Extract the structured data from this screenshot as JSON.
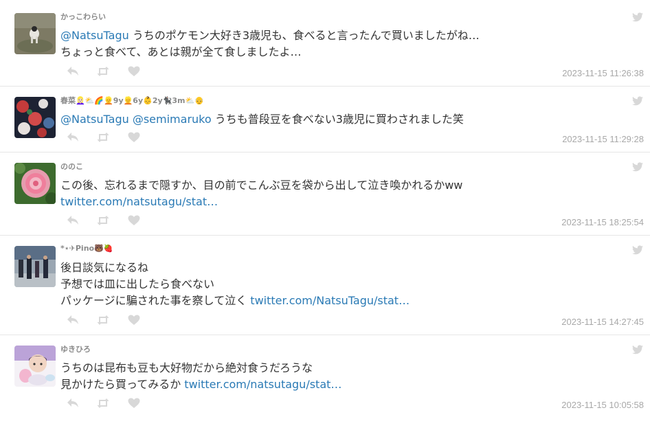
{
  "colors": {
    "link": "#2a7ab5",
    "icon": "#d8d8d8",
    "author": "#8a8a8a",
    "timestamp": "#a8a8a8"
  },
  "tweets": [
    {
      "author": "かっこわらい",
      "line1_pre": "",
      "line1_mention1": "@NatsuTagu",
      "line1_mention2": "",
      "line1_text": " うちのポケモン大好き3歳児も、食べると言ったんで買いましたがね…",
      "line2_text": "ちょっと食べて、あとは親が全て食しましたよ…",
      "line2_link": "",
      "line3_text": "",
      "line3_link": "",
      "timestamp": "2023-11-15 11:26:38"
    },
    {
      "author": "春菜👱🏻‍♀️⛅️🌈👱9y👱6y👶2y🐈‍⬛3m⛅️👴",
      "line1_pre": "",
      "line1_mention1": "@NatsuTagu",
      "line1_mention2": " @semimaruko",
      "line1_text": " うちも普段豆を食べない3歳児に買わされました笑",
      "line2_text": "",
      "line2_link": "",
      "line3_text": "",
      "line3_link": "",
      "timestamp": "2023-11-15 11:29:28"
    },
    {
      "author": "ののこ",
      "line1_pre": "この後、忘れるまで隠すか、目の前でこんぶ豆を袋から出して泣き喚かれるかww",
      "line1_mention1": "",
      "line1_mention2": "",
      "line1_text": "",
      "line2_text": "",
      "line2_link": "twitter.com/natsutagu/stat…",
      "line3_text": "",
      "line3_link": "",
      "timestamp": "2023-11-15 18:25:54"
    },
    {
      "author": "*⋆✈Pino🐻🍓",
      "line1_pre": "後日談気になるね",
      "line1_mention1": "",
      "line1_mention2": "",
      "line1_text": "",
      "line2_text": "予想では皿に出したら食べない",
      "line2_link": "",
      "line3_text": "パッケージに騙された事を察して泣く ",
      "line3_link": "twitter.com/NatsuTagu/stat…",
      "timestamp": "2023-11-15 14:27:45"
    },
    {
      "author": "ゆきひろ",
      "line1_pre": "うちのは昆布も豆も大好物だから絶対食うだろうな",
      "line1_mention1": "",
      "line1_mention2": "",
      "line1_text": "",
      "line2_text": "見かけたら買ってみるか ",
      "line2_link": "twitter.com/natsutagu/stat…",
      "line3_text": "",
      "line3_link": "",
      "timestamp": "2023-11-15 10:05:58"
    }
  ]
}
